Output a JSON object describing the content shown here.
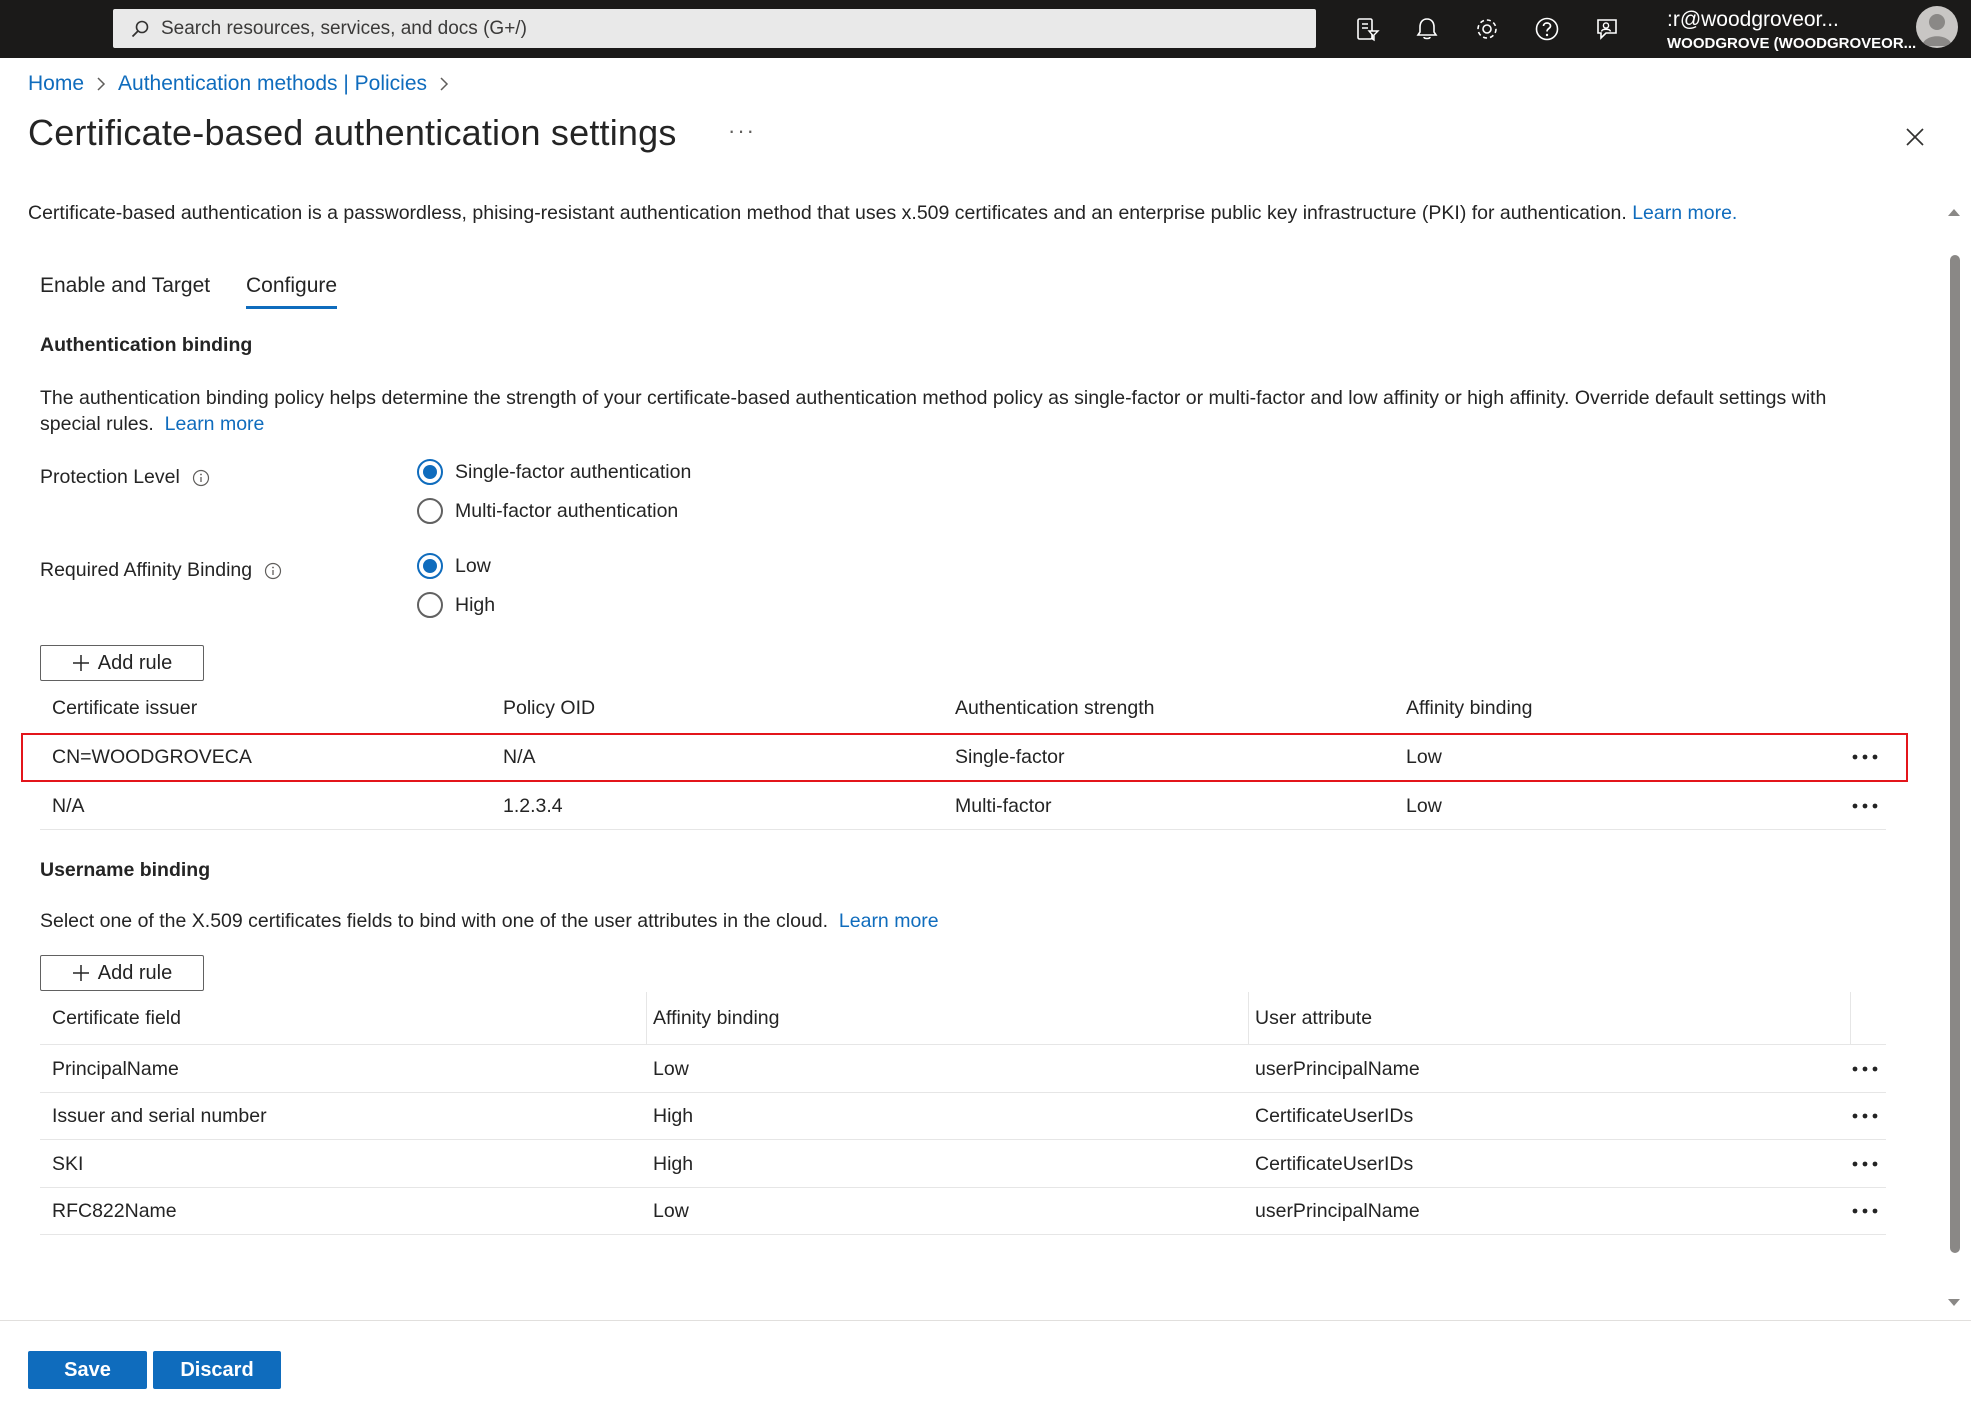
{
  "topbar": {
    "search_placeholder": "Search resources, services, and docs (G+/)",
    "account_user": ":r@woodgroveor...",
    "account_tenant": "WOODGROVE (WOODGROVEOR..."
  },
  "breadcrumb": {
    "home": "Home",
    "parent": "Authentication methods | Policies"
  },
  "page": {
    "title": "Certificate-based authentication settings",
    "intro": "Certificate-based authentication is a passwordless, phising-resistant authentication method that uses x.509 certificates and an enterprise public key infrastructure (PKI) for authentication.",
    "intro_link": "Learn more."
  },
  "tabs": [
    "Enable and Target",
    "Configure"
  ],
  "auth_binding": {
    "heading": "Authentication binding",
    "description_line1": "The authentication binding policy helps determine the strength of your certificate-based authentication method policy as single-factor or multi-factor and low affinity or high affinity. Override default settings with",
    "description_line2": "special rules.",
    "learn_more": "Learn more",
    "protection_label": "Protection Level",
    "protection_options": [
      "Single-factor authentication",
      "Multi-factor authentication"
    ],
    "protection_selected": 0,
    "affinity_label": "Required Affinity Binding",
    "affinity_options": [
      "Low",
      "High"
    ],
    "affinity_selected": 0,
    "add_rule": "Add rule",
    "columns": [
      "Certificate issuer",
      "Policy OID",
      "Authentication strength",
      "Affinity binding"
    ],
    "rows": [
      [
        "CN=WOODGROVECA",
        "N/A",
        "Single-factor",
        "Low"
      ],
      [
        "N/A",
        "1.2.3.4",
        "Multi-factor",
        "Low"
      ]
    ]
  },
  "username_binding": {
    "heading": "Username binding",
    "description": "Select one of the X.509 certificates fields to bind with one of the user attributes in the cloud.",
    "learn_more": "Learn more",
    "add_rule": "Add rule",
    "columns": [
      "Certificate field",
      "Affinity binding",
      "User attribute"
    ],
    "rows": [
      [
        "PrincipalName",
        "Low",
        "userPrincipalName"
      ],
      [
        "Issuer and serial number",
        "High",
        "CertificateUserIDs"
      ],
      [
        "SKI",
        "High",
        "CertificateUserIDs"
      ],
      [
        "RFC822Name",
        "Low",
        "userPrincipalName"
      ]
    ]
  },
  "footer": {
    "save": "Save",
    "discard": "Discard"
  },
  "colors": {
    "accent": "#0f6cbd",
    "topbar": "#1b1a19",
    "highlight": "#e3151b"
  }
}
